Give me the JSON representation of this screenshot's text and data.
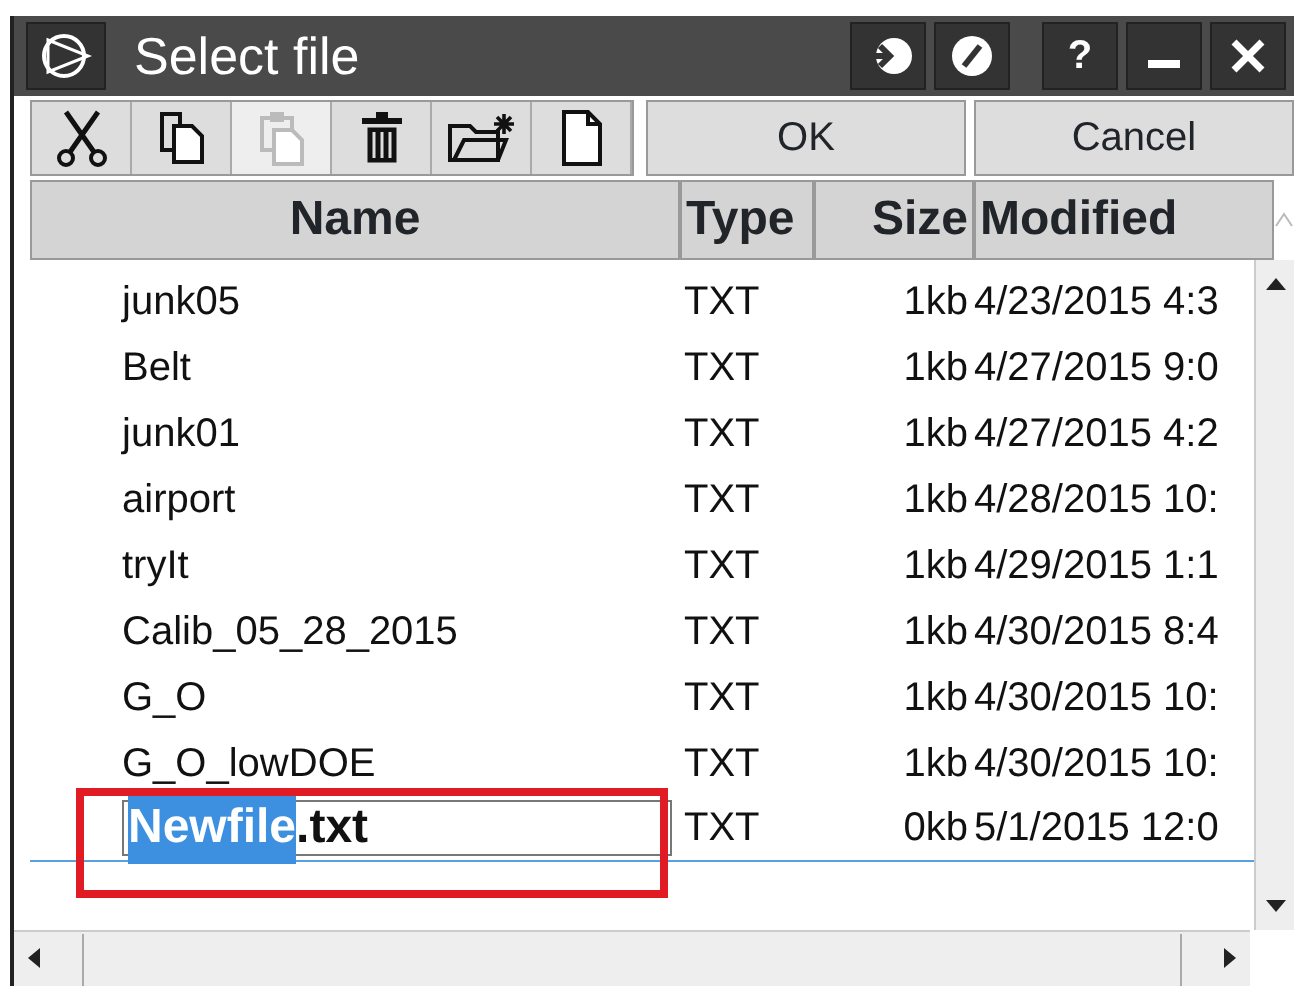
{
  "window": {
    "title": "Select file",
    "help": "?"
  },
  "toolbar": [
    {
      "kind": "cut",
      "disabled": false
    },
    {
      "kind": "copy",
      "disabled": false
    },
    {
      "kind": "paste",
      "disabled": true
    },
    {
      "kind": "delete",
      "disabled": false
    },
    {
      "kind": "new-folder",
      "disabled": false
    },
    {
      "kind": "new-file",
      "disabled": false
    }
  ],
  "buttons": [
    "OK",
    "Cancel"
  ],
  "table": {
    "columns": [
      "Name",
      "Type",
      "Size",
      "Modified"
    ],
    "rows": [
      {
        "kind": "file",
        "name": "junk05",
        "type": "TXT",
        "size": "1kb",
        "modified": "4/23/2015 4:3",
        "selected": false
      },
      {
        "kind": "file",
        "name": "Belt",
        "type": "TXT",
        "size": "1kb",
        "modified": "4/27/2015 9:0",
        "selected": false
      },
      {
        "kind": "file",
        "name": "junk01",
        "type": "TXT",
        "size": "1kb",
        "modified": "4/27/2015 4:2",
        "selected": false
      },
      {
        "kind": "file",
        "name": "airport",
        "type": "TXT",
        "size": "1kb",
        "modified": "4/28/2015 10:",
        "selected": false
      },
      {
        "kind": "file",
        "name": "tryIt",
        "type": "TXT",
        "size": "1kb",
        "modified": "4/29/2015 1:1",
        "selected": false
      },
      {
        "kind": "file",
        "name": "Calib_05_28_2015",
        "type": "TXT",
        "size": "1kb",
        "modified": "4/30/2015 8:4",
        "selected": false
      },
      {
        "kind": "file",
        "name": "G_O",
        "type": "TXT",
        "size": "1kb",
        "modified": "4/30/2015 10:",
        "selected": false
      },
      {
        "kind": "file",
        "name": "G_O_lowDOE",
        "type": "TXT",
        "size": "1kb",
        "modified": "4/30/2015 10:",
        "selected": false
      },
      {
        "kind": "editing",
        "value_parts": [
          {
            "text": "Newfile",
            "selected": true
          },
          {
            "text": ".txt",
            "selected": false
          }
        ],
        "type": "TXT",
        "size": "0kb",
        "modified": "5/1/2015 12:0",
        "selected": true
      }
    ]
  }
}
